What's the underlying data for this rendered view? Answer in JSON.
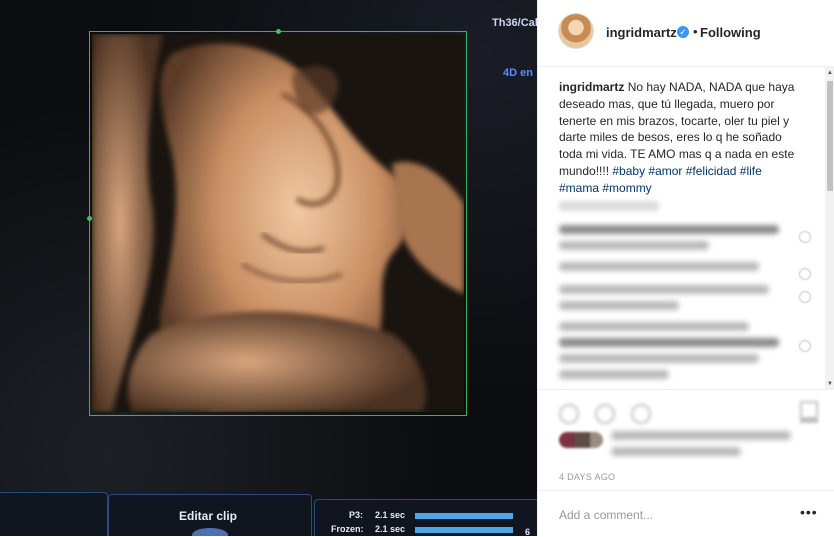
{
  "photo": {
    "scanner_text": {
      "top_right": "Th36/Cal",
      "mode": "4D en"
    },
    "bottom_panel": {
      "edit_clip_label": "Editar clip",
      "p3_label": "P3:",
      "p3_value": "2.1 sec",
      "frozen_label": "Frozen:",
      "frozen_value": "2.1 sec",
      "counter": "6"
    }
  },
  "post": {
    "header": {
      "username": "ingridmartz",
      "verified_glyph": "✓",
      "separator": "•",
      "follow_status": "Following"
    },
    "caption": {
      "username": "ingridmartz",
      "text": "No hay NADA, NADA que haya deseado mas, que tú llegada, muero por tenerte en mis brazos, tocarte, oler tu piel y darte miles de besos, eres lo q he soñado toda mi vida. TE AMO mas q a nada en este mundo!!!! ",
      "hashtags": "#baby #amor #felicidad #life #mama #mommy"
    },
    "timestamp": "4 DAYS AGO",
    "add_comment_placeholder": "Add a comment...",
    "more_glyph": "•••",
    "scroll_up_glyph": "▲",
    "scroll_down_glyph": "▼",
    "icons": {
      "verified": "verified-badge-icon",
      "like": "heart-icon",
      "comment": "comment-icon",
      "share": "share-icon",
      "save": "bookmark-icon",
      "more": "more-options-icon"
    },
    "colors": {
      "verified_blue": "#3897f0",
      "hashtag_blue": "#003569",
      "text_dark": "#262626",
      "text_muted": "#999999"
    }
  }
}
